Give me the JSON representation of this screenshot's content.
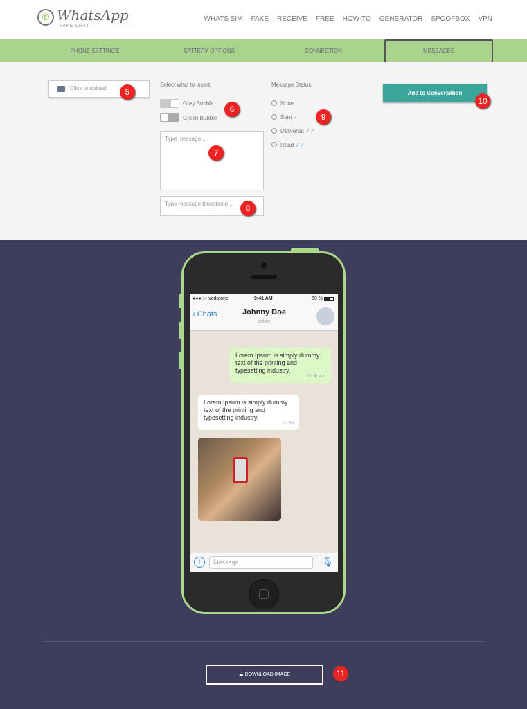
{
  "header": {
    "logo_title": "WhatsApp",
    "logo_subtitle": "FAKE CHAT",
    "nav": [
      "WHATS SIM",
      "FAKE",
      "RECEIVE",
      "FREE",
      "HOW-TO",
      "GENERATOR",
      "SPOOFBOX",
      "VPN"
    ]
  },
  "tabs": [
    {
      "label": "PHONE SETTINGS"
    },
    {
      "label": "BATTERY OPTIONS"
    },
    {
      "label": "CONNECTION"
    },
    {
      "label": "MESSAGES",
      "active": true
    }
  ],
  "panel": {
    "upload_label": "Click to upload",
    "insert_label": "Select what to insert:",
    "grey_bubble": "Grey Bubble",
    "green_bubble": "Green Bubble",
    "message_placeholder": "Type message ...",
    "timestamp_placeholder": "Type message timestamp ...",
    "status_label": "Message Status:",
    "statuses": [
      "None",
      "Sent",
      "Delivered",
      "Read"
    ],
    "add_button": "Add to Conversation"
  },
  "annotations": [
    "5",
    "6",
    "7",
    "8",
    "9",
    "10",
    "11"
  ],
  "phone": {
    "carrier": "●●●○○ vodafone",
    "time": "9:41 AM",
    "battery": "50 %",
    "back": "Chats",
    "contact": "Johnny Doe",
    "presence": "online",
    "messages": [
      {
        "type": "green",
        "text": "Lorem Ipsum is simply dummy text of the printing and typesetting industry.",
        "time": "21:38",
        "status": "read"
      },
      {
        "type": "grey",
        "text": "Lorem Ipsum is simply dummy text of the printing and typesetting industry.",
        "time": "21:38"
      }
    ],
    "compose_placeholder": "Message"
  },
  "download": {
    "label": "DOWNLOAD IMAGE"
  },
  "colors": {
    "tab_bar": "#aad48e",
    "button": "#3aa69a",
    "background": "#3f3d5c",
    "phone_border": "#a9d98a",
    "read_check": "#4fa3d9"
  }
}
